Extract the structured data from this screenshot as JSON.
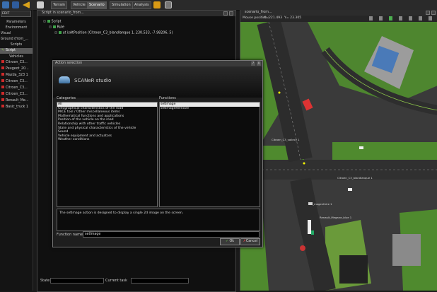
{
  "toolbar": {
    "tabs": [
      "Terrain",
      "Vehicle",
      "Scenario",
      "Simulation",
      "Analysis"
    ],
    "active_tab": "Scenario"
  },
  "left_panel": {
    "combo_value": "EDIT",
    "sections": [
      "Parameters",
      "Environment",
      "Visual",
      "Ground (from_...",
      "Scripts"
    ],
    "selected_item": "Script",
    "vehicles_header": "Vehicles",
    "vehicles": [
      "Citroen_C3...",
      "Peugeot_20...",
      "Mazda_323 1",
      "Citroen_C3...",
      "Citroen_C3...",
      "Citroen_C3...",
      "Renault_Me...",
      "Basic_truck 1"
    ]
  },
  "script_window": {
    "title": "Script in scenario_from...",
    "tree": {
      "root": "Script",
      "rule": "Rule",
      "action": "ut  isAtPosition  (Citroen_C3_blandlanque 1,  230.533,  -7.98206,  5)"
    },
    "state_label": "State",
    "current_task_label": "Current task"
  },
  "map_window": {
    "title": "scenario_from...",
    "mouse_position_label": "Mouse position :",
    "mouse_x": "X=221.493",
    "mouse_y": "Y= 23.305",
    "vehicle_labels": [
      "Citroen_C3_vallecy 1",
      "Citroen_C3_blandlanque 1",
      "C3_magenthire 1",
      "Renault_Megane_blue 1"
    ]
  },
  "dialog": {
    "title": "Action selection",
    "close_label": "X",
    "help_label": "?",
    "logo_text": "SCANeR studio",
    "categories_label": "Categories",
    "functions_label": "Functions",
    "categories": [
      "All",
      "Geographical characteristics of the road",
      "MICE tool / Other miscellaneous items",
      "Mathematical functions and applications",
      "Position of the vehicle on the road",
      "Relationship with other traffic vehicles",
      "State and physical characteristics of the vehicle",
      "Sound",
      "Vehicle equipment and actuators",
      "Weather conditions"
    ],
    "selected_category": "All",
    "functions": [
      "setImage",
      "setImageRemove"
    ],
    "selected_function": "setImage",
    "description": "The setImage action is designed to display a single 2d image on the screen.",
    "function_name_label": "Function name",
    "function_name_value": "setImage",
    "ok_label": "Ok",
    "cancel_label": "Cancel"
  },
  "colors": {
    "background": "#1a1a1a",
    "panel": "#101010",
    "road": "#3c3c3c",
    "grass": "#4f8a2e",
    "selection": "#e8e8e8",
    "tree_check": "#3fa34a"
  }
}
